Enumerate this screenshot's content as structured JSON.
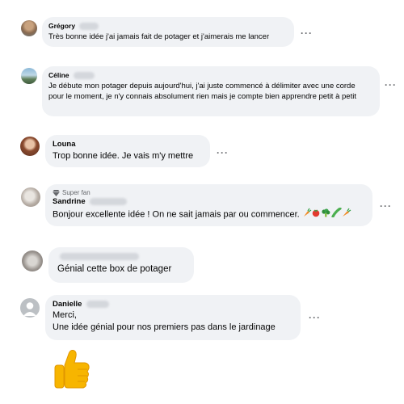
{
  "comments": [
    {
      "name": "Grégory",
      "text": "Très bonne idée j'ai jamais fait de potager et j'aimerais me lancer"
    },
    {
      "name": "Céline",
      "text": "Je débute mon potager depuis aujourd'hui, j'ai juste commencé à délimiter avec une corde pour le moment, je n'y connais absolument rien mais je compte bien apprendre petit à petit"
    },
    {
      "name": "Louna",
      "text": "Trop bonne idée. Je vais m'y mettre"
    },
    {
      "badge": "Super fan",
      "name": "Sandrine",
      "text": "Bonjour excellente idée ! On ne sait jamais par ou commencer."
    },
    {
      "name": "",
      "text": "Génial cette box de potager"
    },
    {
      "name": "Danielle",
      "text_line1": "Merci,",
      "text_line2": "Une idée génial pour nos premiers pas dans le jardinage"
    }
  ],
  "icons": {
    "more": "more-options-icon",
    "thumbs_up": "thumbs-up-icon",
    "super_fan": "diamond-icon",
    "veggies": [
      "carrot",
      "tomato",
      "broccoli",
      "cucumber",
      "carrot"
    ]
  },
  "colors": {
    "bubble": "#f0f2f5",
    "text": "#050505",
    "secondary": "#65676b",
    "thumb": "#f7b500"
  }
}
